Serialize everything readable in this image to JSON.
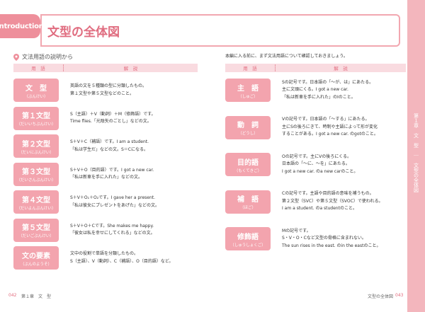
{
  "header": {
    "tab": "introduction",
    "title": "文型の全体図"
  },
  "section": {
    "title": "文法用語の説明から"
  },
  "table_head": {
    "term": "用　語",
    "desc": "解　説"
  },
  "right_intro": "本編に入る前に、まず文法用語について確認しておきましょう。",
  "side_label": "第１章　文　型　｜　文型の全体図",
  "left_rows": [
    {
      "term": "文　型",
      "reading": "（ぶんけい）",
      "lines": [
        "英語の文を５種類の型に分類したもの。",
        "第１文型や第５文型などのこと。"
      ]
    },
    {
      "term": "第１文型",
      "reading": "（だいいちぶんけい）",
      "lines": [
        "S（主語）＋V（動詞）＋M（修飾語）です。",
        "Time flies.「光陰矢のごとし」などの文。"
      ]
    },
    {
      "term": "第２文型",
      "reading": "（だいにぶんけい）",
      "lines": [
        "S＋V＋C（補語）です。I am a student.",
        "「私は学生だ」などの文。S＝Cになる。"
      ]
    },
    {
      "term": "第３文型",
      "reading": "（だいさんぶんけい）",
      "lines": [
        "S＋V＋O（目的語）です。I got a new car.",
        "「私は新車を手に入れた」などの文。"
      ]
    },
    {
      "term": "第４文型",
      "reading": "（だいよんぶんけい）",
      "lines": [
        "S＋V＋O₁＋O₂です。I gave her a present.",
        "「私は彼女にプレゼントをあげた」などの文。"
      ]
    },
    {
      "term": "第５文型",
      "reading": "（だいごぶんけい）",
      "lines": [
        "S＋V＋O＋Cです。She makes me happy.",
        "「彼女は私を幸せにしてくれる」などの文。"
      ]
    },
    {
      "term": "文の要素",
      "reading": "（ぶんのようそ）",
      "lines": [
        "文中の役割で単語を分類したもの。",
        "S（主語）、V（動詞）、C（補語）、O（目的語）など。"
      ]
    }
  ],
  "right_rows": [
    {
      "term": "主　語",
      "reading": "（しゅご）",
      "lines": [
        "Sの記号です。日本語の「～が、は」にあたる。",
        "主に文頭にくる。I got a new car.",
        "「私は新車を手に入れた」のIのこと。"
      ]
    },
    {
      "term": "動　詞",
      "reading": "（どうし）",
      "lines": [
        "Vの記号です。日本語の「～する」にあたる。",
        "主にSの後ろにきて、時制や主語によって形が変化",
        "することがある。I got a new car. のgotのこと。"
      ]
    },
    {
      "term": "目的語",
      "reading": "（もくてきご）",
      "lines": [
        "Oの記号です。主にVの後ろにくる。",
        "日本語の「～に、～を」にあたる。",
        "I got a new car. のa new carのこと。"
      ]
    },
    {
      "term": "補　語",
      "reading": "（ほご）",
      "lines": [
        "Cの記号です。主語や目的語の意味を補うもの。",
        "第２文型（SVC）や第５文型（SVOC）で使われる。",
        "I am a student. のa studentのこと。"
      ]
    },
    {
      "term": "修飾語",
      "reading": "（しゅうしょくご）",
      "lines": [
        "Mの記号です。",
        "S・V・O・Cなど文型の骨格に含まれない。",
        "The sun rises in the east. のin the eastのこと。"
      ]
    }
  ],
  "footer": {
    "left_page": "042",
    "left_text": "第１章　文　型",
    "right_text": "文型の全体図",
    "right_page": "043"
  }
}
